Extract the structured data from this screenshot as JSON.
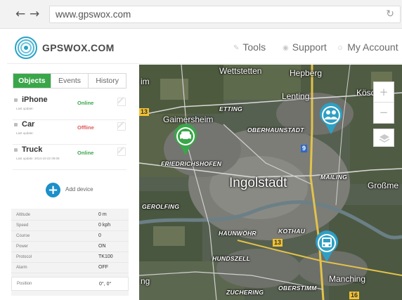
{
  "browser": {
    "back_glyph": "←",
    "forward_glyph": "→",
    "url": "www.gpswox.com",
    "reload_glyph": "↻"
  },
  "header": {
    "brand": "GPSWOX.COM",
    "menu": [
      {
        "label": "Tools",
        "icon": "wrench-icon"
      },
      {
        "label": "Support",
        "icon": "lifebuoy-icon"
      },
      {
        "label": "My Account",
        "icon": "user-icon"
      }
    ]
  },
  "sidebar": {
    "tabs": [
      {
        "label": "Objects",
        "active": true
      },
      {
        "label": "Events",
        "active": false
      },
      {
        "label": "History",
        "active": false
      }
    ],
    "objects": [
      {
        "name": "iPhone",
        "sub": "Last update:",
        "status": "Online",
        "state": "online"
      },
      {
        "name": "Car",
        "sub": "Last update:",
        "status": "Offline",
        "state": "offline"
      },
      {
        "name": "Truck",
        "sub": "Last update: 2014-10-22 09:08",
        "status": "Online",
        "state": "online"
      }
    ],
    "add_device_label": "Add device",
    "add_icon_glyph": "+",
    "details": [
      {
        "label": "Altitude",
        "value": "0 m"
      },
      {
        "label": "Speed",
        "value": "0 kph"
      },
      {
        "label": "Course",
        "value": "0"
      },
      {
        "label": "Power",
        "value": "ON"
      },
      {
        "label": "Protocol",
        "value": "TK100"
      },
      {
        "label": "Alarm",
        "value": "OFF"
      }
    ],
    "position": {
      "label": "Position",
      "value": "0°, 0°"
    }
  },
  "map": {
    "labels": {
      "wettstetten": "Wettstetten",
      "hepberg": "Hepberg",
      "lenting": "Lenting",
      "koschin": "Köschin",
      "gaimersheim": "Gaimersheim",
      "etting": "ETTING",
      "oberhaunstadt": "OBERHAUNSTADT",
      "friedrichshofen": "FRIEDRICHSHOFEN",
      "ingolstadt": "Ingolstadt",
      "mailing": "MAILING",
      "grossme": "Großme",
      "gerolfing": "GEROLFING",
      "haunwohr": "HAUNWÖHR",
      "kothau": "KOTHAU",
      "hundszell": "HUNDSZELL",
      "manching": "Manching",
      "zuchering": "ZUCHERING",
      "oberstimm": "OBERSTIMM",
      "im": "im",
      "ng": "ng"
    },
    "road_numbers": {
      "r13a": "13",
      "r9": "9",
      "r13b": "13",
      "r16": "16"
    },
    "zoom_in_glyph": "+",
    "zoom_out_glyph": "−",
    "markers": [
      {
        "name": "car-marker",
        "icon": "car-icon",
        "color": "#3aa64a"
      },
      {
        "name": "people-marker",
        "icon": "people-icon",
        "color": "#2e9fc4"
      },
      {
        "name": "truck-marker",
        "icon": "truck-icon",
        "color": "#2e9fc4"
      }
    ]
  },
  "colors": {
    "accent_green": "#3aa64a",
    "offline_red": "#e05858",
    "marker_blue": "#2e9fc4",
    "add_blue": "#1d8fc9"
  }
}
